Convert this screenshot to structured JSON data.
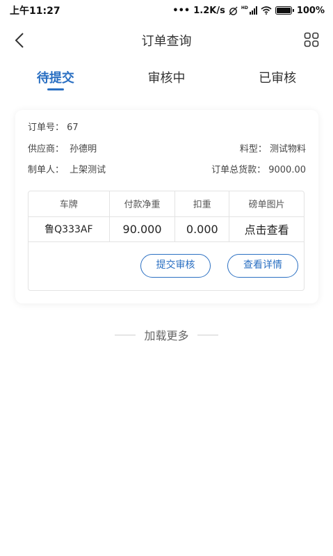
{
  "status_bar": {
    "time": "上午11:27",
    "speed": "1.2K/s",
    "network_label": "HD",
    "battery": "100%"
  },
  "nav": {
    "title": "订单查询"
  },
  "tabs": [
    {
      "label": "待提交",
      "active": true
    },
    {
      "label": "审核中",
      "active": false
    },
    {
      "label": "已审核",
      "active": false
    }
  ],
  "order": {
    "order_no_label": "订单号：",
    "order_no": "67",
    "supplier_label": "供应商：",
    "supplier": "孙德明",
    "material_label": "料型：",
    "material": "测试物料",
    "creator_label": "制单人：",
    "creator": "上架测试",
    "total_label": "订单总货款：",
    "total": "9000.00",
    "table": {
      "headers": [
        "车牌",
        "付款净重",
        "扣重",
        "磅单图片"
      ],
      "row": {
        "plate": "鲁Q333AF",
        "net_weight": "90.000",
        "deduction": "0.000",
        "image_link": "点击查看"
      }
    },
    "submit_label": "提交审核",
    "detail_label": "查看详情"
  },
  "load_more": "加载更多",
  "colors": {
    "accent": "#2a6fc2"
  }
}
